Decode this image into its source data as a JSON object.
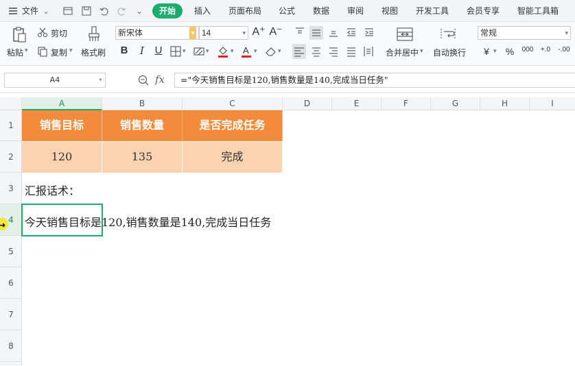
{
  "menubar": {
    "file_label": "文件",
    "tabs": [
      "开始",
      "插入",
      "页面布局",
      "公式",
      "数据",
      "审阅",
      "视图",
      "开发工具",
      "会员专享",
      "智能工具箱"
    ]
  },
  "ribbon": {
    "paste_label": "粘贴",
    "cut_label": "剪切",
    "copy_label": "复制",
    "format_painter_label": "格式刷",
    "font_name": "新宋体",
    "font_size": "14",
    "merge_label": "合并居中",
    "wrap_label": "自动换行",
    "number_format": "常规",
    "currency_symbol": "¥",
    "percent_symbol": "%",
    "thousands_symbol": "000",
    "increase_decimal": "+.0",
    "decrease_decimal": "-.00",
    "colors": {
      "accent": "#1aad6e",
      "font_color": "#e02020",
      "fill_color": "#e02020"
    }
  },
  "formula_bar": {
    "name_box": "A4",
    "fx_label": "fx",
    "formula": "=\"今天销售目标是120,销售数量是140,完成当日任务\""
  },
  "sheet": {
    "columns": [
      "A",
      "B",
      "C",
      "D",
      "E",
      "F",
      "G",
      "H",
      "I"
    ],
    "rows": [
      "1",
      "2",
      "3",
      "4",
      "5",
      "6",
      "7",
      "8"
    ],
    "header_row": [
      "销售目标",
      "销售数量",
      "是否完成任务"
    ],
    "value_row": [
      "120",
      "135",
      "完成"
    ],
    "a3_text": "汇报话术：",
    "a4_text": "今天销售目标是120,销售数量是140,完成当日任务",
    "colors": {
      "header_fill": "#f28b3c",
      "value_fill": "#fbd3b1",
      "selection": "#1aad6e"
    }
  }
}
